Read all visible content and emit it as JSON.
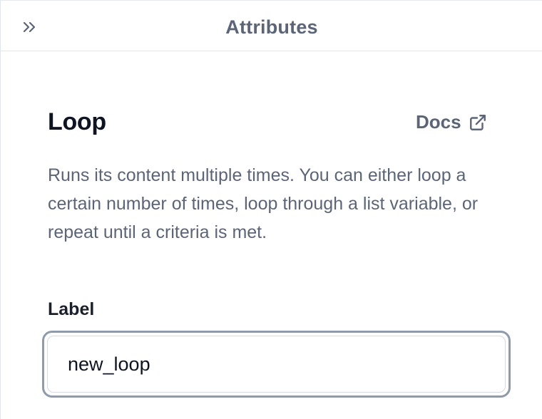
{
  "topbar": {
    "title": "Attributes",
    "collapse_icon": "double-chevron-right-icon"
  },
  "block": {
    "title": "Loop",
    "docs_label": "Docs",
    "docs_icon": "external-link-icon",
    "description": "Runs its content multiple times. You can either loop a certain number of times, loop through a list variable, or repeat until a criteria is met."
  },
  "label_field": {
    "label": "Label",
    "value": "new_loop"
  },
  "colors": {
    "heading": "#0f1422",
    "muted_text": "#5c6577",
    "focus_ring": "#8f9aab",
    "border": "#e2e6ec"
  }
}
